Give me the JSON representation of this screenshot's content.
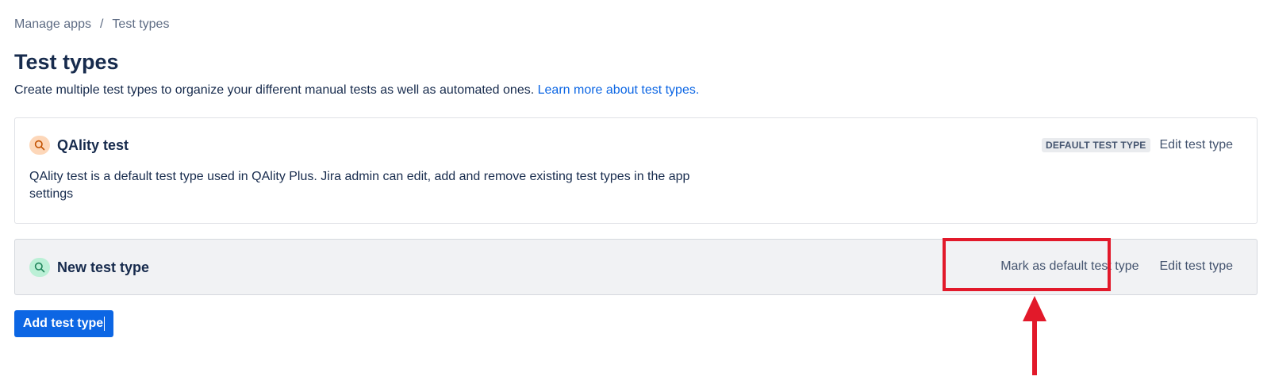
{
  "breadcrumb": {
    "items": [
      "Manage apps",
      "Test types"
    ],
    "separator": "/"
  },
  "page": {
    "title": "Test types",
    "description": "Create multiple test types to organize your different manual tests as well as automated ones.",
    "learn_more_link": "Learn more about test types."
  },
  "test_types": [
    {
      "name": "QAlity test",
      "icon": "search-icon",
      "icon_color": "#c25100",
      "icon_bg": "#fdd7b9",
      "description": "QAlity test is a default test type used in QAlity Plus. Jira admin can edit, add and remove existing test types in the app settings",
      "badge": "DEFAULT TEST TYPE",
      "edit_label": "Edit test type"
    },
    {
      "name": "New test type",
      "icon": "search-icon",
      "icon_color": "#1f845a",
      "icon_bg": "#bbf0d6",
      "mark_default_label": "Mark as default test type",
      "edit_label": "Edit test type"
    }
  ],
  "actions": {
    "add_button_label": "Add test type"
  },
  "annotation": {
    "highlight_color": "#e2192a"
  },
  "colors": {
    "primary": "#0c66e4",
    "text": "#172b4d",
    "subtle": "#44546f"
  }
}
